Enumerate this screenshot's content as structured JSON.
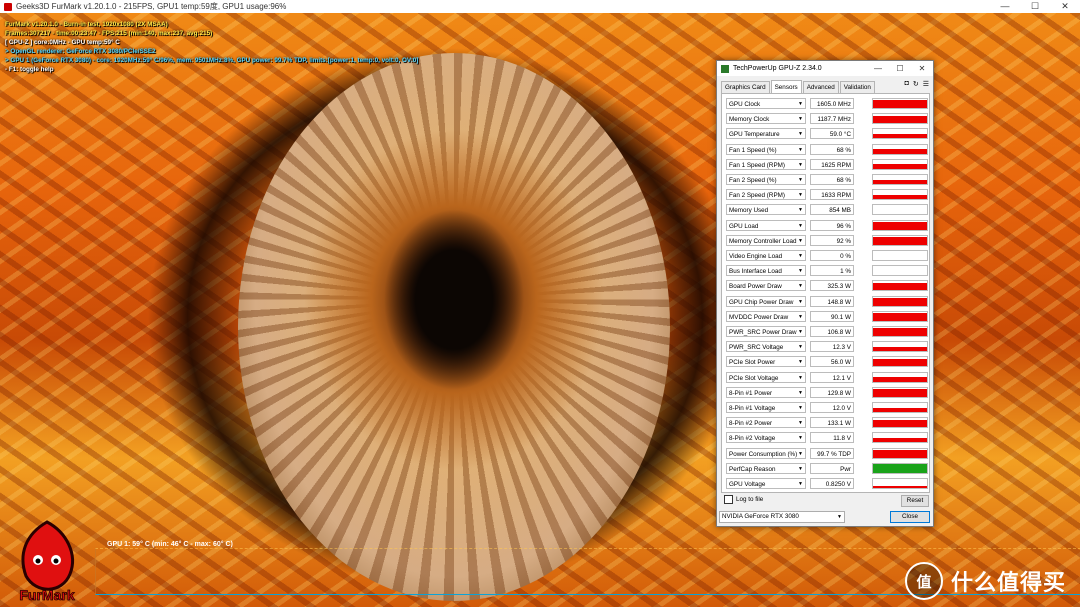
{
  "furmark_window": {
    "title": "Geeks3D FurMark v1.20.1.0 - 215FPS, GPU1 temp:59度, GPU1 usage:96%",
    "controls": {
      "minimize": "—",
      "maximize": "☐",
      "close": "✕"
    }
  },
  "osd": {
    "line1": "FurMark v1.20.1.0 - Burn-in test, 1920x1080 (2X MSAA)",
    "line2": "Frames:307217 - time:00:23:47 - FPS:215 (min:140, max:237, avg:215)",
    "line3": "[ GPU-Z ] core:0MHz - GPU temp:59° C",
    "line4": "> OpenGL renderer: GeForce RTX 3080/PCIe/SSE2",
    "line5": "> GPU 1 (GeForce RTX 3080) - core: 1920MHz:59° C/96%, mem: 9501MHz:8%, GPU power: 99.7% TDP, limits:[power:1, temp:0, volt:0, OV:0]",
    "line6": "- F1: toggle help"
  },
  "temp_monitor": {
    "label": "GPU 1: 59° C (min: 46° C - max: 60° C)"
  },
  "watermark": {
    "badge": "值",
    "text": "什么值得买"
  },
  "logo": {
    "text": "FurMark"
  },
  "gpuz": {
    "title": "TechPowerUp GPU-Z 2.34.0",
    "controls": {
      "minimize": "—",
      "maximize": "☐",
      "close": "✕"
    },
    "tabs": [
      "Graphics Card",
      "Sensors",
      "Advanced",
      "Validation"
    ],
    "tool_icons": [
      "camera-icon",
      "refresh-icon",
      "menu-icon"
    ],
    "tool_glyphs": [
      "◘",
      "↻",
      "☰"
    ],
    "sensors": [
      {
        "name": "GPU Clock",
        "value": "1605.0 MHz",
        "level": 0.85
      },
      {
        "name": "Memory Clock",
        "value": "1187.7 MHz",
        "level": 0.85
      },
      {
        "name": "GPU Temperature",
        "value": "59.0 °C",
        "level": 0.5
      },
      {
        "name": "Fan 1 Speed (%)",
        "value": "68 %",
        "level": 0.5
      },
      {
        "name": "Fan 1 Speed (RPM)",
        "value": "1625 RPM",
        "level": 0.5
      },
      {
        "name": "Fan 2 Speed (%)",
        "value": "68 %",
        "level": 0.5
      },
      {
        "name": "Fan 2 Speed (RPM)",
        "value": "1633 RPM",
        "level": 0.5
      },
      {
        "name": "Memory Used",
        "value": "854 MB",
        "level": 0.08
      },
      {
        "name": "GPU Load",
        "value": "96 %",
        "level": 0.9
      },
      {
        "name": "Memory Controller Load",
        "value": "92 %",
        "level": 0.85
      },
      {
        "name": "Video Engine Load",
        "value": "0 %",
        "level": 0
      },
      {
        "name": "Bus Interface Load",
        "value": "1 %",
        "level": 0
      },
      {
        "name": "Board Power Draw",
        "value": "325.3 W",
        "level": 0.85
      },
      {
        "name": "GPU Chip Power Draw",
        "value": "148.8 W",
        "level": 0.85
      },
      {
        "name": "MVDDC Power Draw",
        "value": "90.1 W",
        "level": 0.85
      },
      {
        "name": "PWR_SRC Power Draw",
        "value": "106.8 W",
        "level": 0.85
      },
      {
        "name": "PWR_SRC Voltage",
        "value": "12.3 V",
        "level": 0.5
      },
      {
        "name": "PCIe Slot Power",
        "value": "56.0 W",
        "level": 0.85
      },
      {
        "name": "PCIe Slot Voltage",
        "value": "12.1 V",
        "level": 0.5
      },
      {
        "name": "8-Pin #1 Power",
        "value": "129.8 W",
        "level": 0.85
      },
      {
        "name": "8-Pin #1 Voltage",
        "value": "12.0 V",
        "level": 0.5
      },
      {
        "name": "8-Pin #2 Power",
        "value": "133.1 W",
        "level": 0.85
      },
      {
        "name": "8-Pin #2 Voltage",
        "value": "11.8 V",
        "level": 0.5
      },
      {
        "name": "Power Consumption (%)",
        "value": "99.7 % TDP",
        "level": 0.85
      },
      {
        "name": "PerfCap Reason",
        "value": "Pwr",
        "level": 1,
        "color": "#1aa31a"
      },
      {
        "name": "GPU Voltage",
        "value": "0.8250 V",
        "level": 0.2
      }
    ],
    "graph_color": "#ee0000",
    "log_label": "Log to file",
    "reset_label": "Reset",
    "device": "NVIDIA GeForce RTX 3080",
    "close_label": "Close"
  }
}
